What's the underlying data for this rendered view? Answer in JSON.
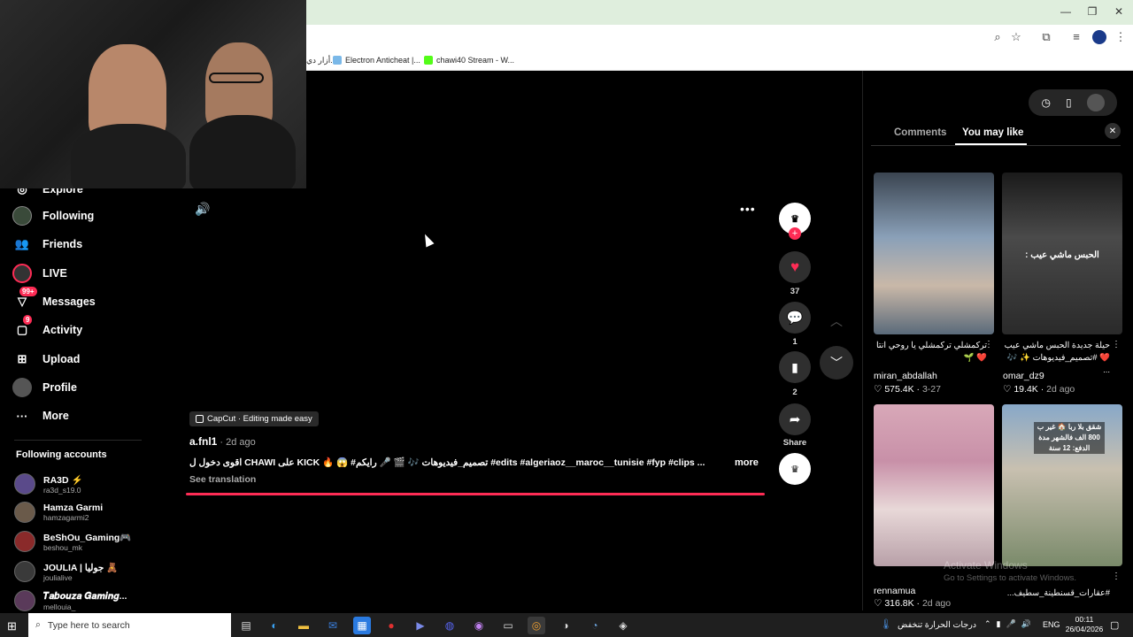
{
  "browser": {
    "bookmarks": [
      {
        "label": "أزار دي..."
      },
      {
        "label": "Electron Anticheat |..."
      },
      {
        "label": "chawi40 Stream - W..."
      }
    ],
    "window_controls": {
      "minimize": "—",
      "maximize": "❐",
      "close": "✕"
    }
  },
  "sidebar": {
    "items": [
      {
        "label": "Explore",
        "icon": "compass-icon"
      },
      {
        "label": "Following",
        "icon": "following-icon"
      },
      {
        "label": "Friends",
        "icon": "friends-icon"
      },
      {
        "label": "LIVE",
        "icon": "live-icon"
      },
      {
        "label": "Messages",
        "icon": "messages-icon",
        "badge": "99+"
      },
      {
        "label": "Activity",
        "icon": "activity-icon",
        "badge": "9"
      },
      {
        "label": "Upload",
        "icon": "upload-icon"
      },
      {
        "label": "Profile",
        "icon": "profile-icon"
      },
      {
        "label": "More",
        "icon": "more-icon"
      }
    ],
    "following_title": "Following accounts",
    "following": [
      {
        "name": "RA3D ⚡",
        "handle": "ra3d_s19.0"
      },
      {
        "name": "Hamza Garmi",
        "handle": "hamzagarmi2"
      },
      {
        "name": "BeShOu_Gaming🎮",
        "handle": "beshou_mk"
      },
      {
        "name": "JOULIA | جوليا 🧸",
        "handle": "joulialive"
      },
      {
        "name": "𝑻𝒂𝒃𝒐𝒖𝒛𝒂 𝑮𝒂𝒎𝒊𝒏𝒈...",
        "handle": "mellouia_"
      }
    ]
  },
  "video": {
    "capcut_label": "CapCut · Editing made easy",
    "author": "a.fnl1",
    "date": " · 2d ago",
    "caption": "اقوى دخول ل CHAWI على KICK 🔥 😱 #تصميم_فيديوهات 🎶 🎬 🎤 رايكم #edits #algeriaoz__maroc__tunisie #fyp #clips ...",
    "more_label": "more",
    "see_translation": "See translation",
    "progress": 1.0
  },
  "actions": {
    "likes": "37",
    "comments": "1",
    "saves": "2",
    "share_label": "Share"
  },
  "right_panel": {
    "tabs": [
      "Comments",
      "You may like"
    ],
    "active_tab": "You may like",
    "videos": [
      {
        "title": "تركمشلي تركمشلي يا روحي انتا ❤️ 🌱",
        "user": "miran_abdallah",
        "likes": "575.4K",
        "date": "3-27"
      },
      {
        "title": "حيلة جديدة الحبس ماشي عيب ❤️ #تصميم_فيديوهات ✨ 🎶 ...",
        "user": "omar_dz9",
        "likes": "19.4K",
        "date": "2d ago"
      },
      {
        "title": "",
        "user": "rennamua",
        "likes": "316.8K",
        "date": "2d ago"
      },
      {
        "title": "#عقارات_قسنطينة_سطيف...",
        "user": "",
        "likes": "",
        "date": ""
      }
    ],
    "thumb_text_2": "الحبس ماشي عيب :",
    "thumb_text_4": "شقق بلا ربا 🏠 غير ب 800 الف فالشهر مدة الدفع: 12 سنة"
  },
  "watermark": {
    "line1": "Activate Windows",
    "line2": "Go to Settings to activate Windows."
  },
  "taskbar": {
    "search_placeholder": "Type here to search",
    "weather": "درجات الحرارة تنخفض",
    "lang": "ENG",
    "time": "00:11",
    "date": "26/04/2026"
  },
  "colors": {
    "accent": "#fe2c55",
    "titlebar": "#dfeedd"
  }
}
